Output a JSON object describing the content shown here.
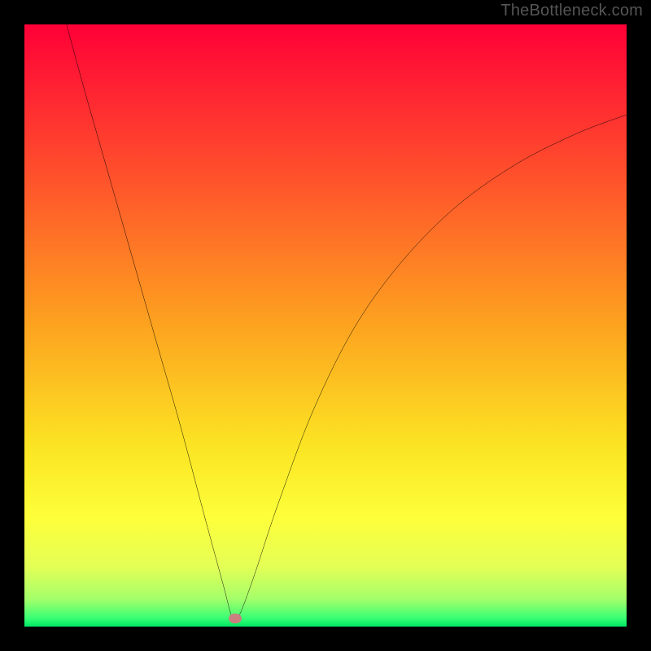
{
  "watermark": "TheBottleneck.com",
  "chart_data": {
    "type": "line",
    "title": "",
    "xlabel": "",
    "ylabel": "",
    "xlim": [
      0,
      100
    ],
    "ylim": [
      0,
      100
    ],
    "grid": false,
    "legend": false,
    "gradient_stops": [
      {
        "offset": 0,
        "color": "#ff0037"
      },
      {
        "offset": 0.28,
        "color": "#ff5a2a"
      },
      {
        "offset": 0.5,
        "color": "#fda31f"
      },
      {
        "offset": 0.7,
        "color": "#fbe423"
      },
      {
        "offset": 0.82,
        "color": "#fdff3a"
      },
      {
        "offset": 0.9,
        "color": "#e4ff55"
      },
      {
        "offset": 0.955,
        "color": "#a3ff6a"
      },
      {
        "offset": 0.985,
        "color": "#3cff74"
      },
      {
        "offset": 1.0,
        "color": "#00e765"
      }
    ],
    "series": [
      {
        "name": "bottleneck-curve",
        "x": [
          7,
          10,
          14,
          18,
          22,
          26,
          30,
          33,
          34.5,
          35.5,
          38,
          42,
          48,
          55,
          63,
          72,
          82,
          92,
          100
        ],
        "y": [
          100,
          89,
          75,
          61,
          47,
          33,
          18,
          7,
          1.5,
          1.5,
          8,
          20,
          36,
          50,
          61,
          70,
          77,
          82,
          85
        ]
      }
    ],
    "marker": {
      "x": 35,
      "y": 1.3,
      "color": "#cb8080"
    }
  }
}
